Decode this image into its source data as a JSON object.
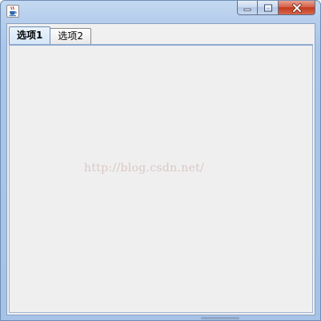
{
  "window": {
    "title": "",
    "icon": "java-cup-icon",
    "caption_buttons": {
      "minimize": "minimize-icon",
      "maximize": "maximize-icon",
      "close": "close-icon"
    }
  },
  "tabs": [
    {
      "label": "选项1",
      "selected": true
    },
    {
      "label": "选项2",
      "selected": false
    }
  ],
  "watermark": "http://blog.csdn.net/",
  "colors": {
    "frame": "#a9c5e8",
    "close_button": "#c2391e",
    "panel_background": "#efefef",
    "selected_tab": "#d5e7f8"
  }
}
